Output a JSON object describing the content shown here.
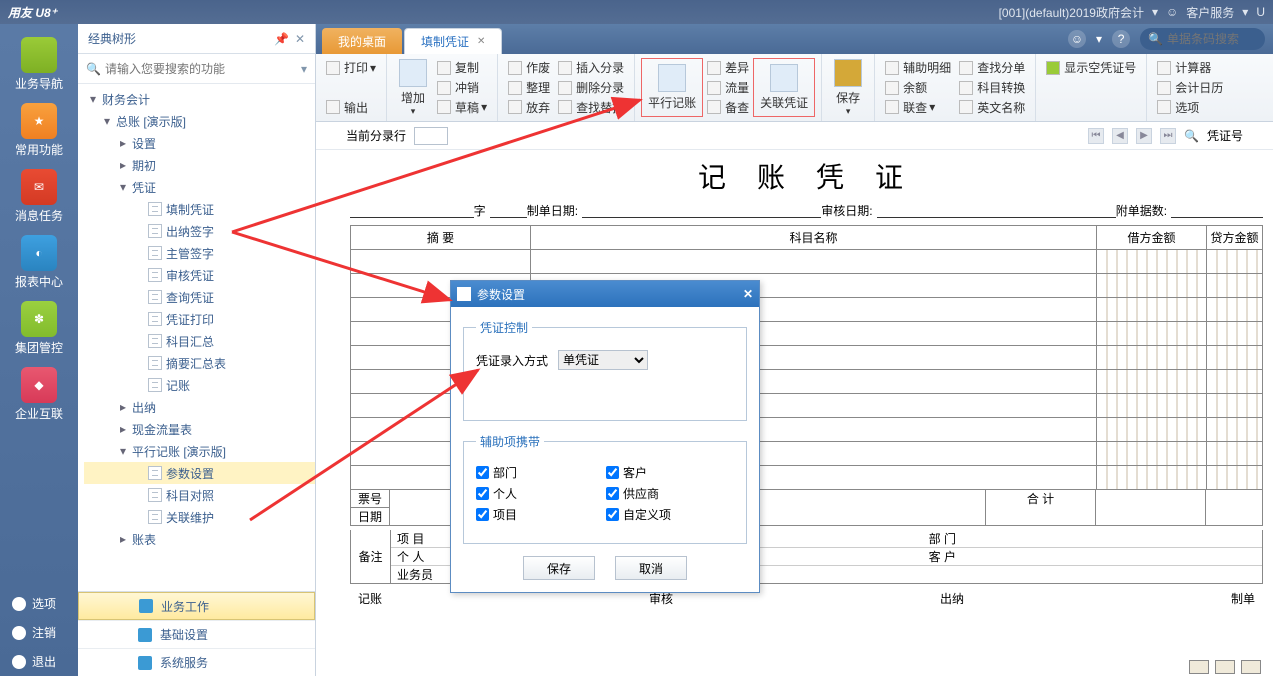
{
  "titlebar": {
    "logo": "用友 U8⁺",
    "org": "[001](default)2019政府会计",
    "service": "客户服务",
    "u": "U"
  },
  "leftrail": {
    "items": [
      {
        "label": "业务导航",
        "color": "c-green"
      },
      {
        "label": "常用功能",
        "color": "c-orange"
      },
      {
        "label": "消息任务",
        "color": "c-red"
      },
      {
        "label": "报表中心",
        "color": "c-blue"
      },
      {
        "label": "集团管控",
        "color": "c-lime"
      },
      {
        "label": "企业互联",
        "color": "c-pink"
      }
    ],
    "options": [
      {
        "label": "选项"
      },
      {
        "label": "注销"
      },
      {
        "label": "退出"
      }
    ]
  },
  "treepanel": {
    "title": "经典树形",
    "search_placeholder": "请输入您要搜索的功能",
    "root": "财务会计",
    "ledger": "总账 [演示版]",
    "pingxing": "平行记账 [演示版]",
    "nodes": {
      "settings": "设置",
      "initial": "期初",
      "voucher": "凭证",
      "fill": "填制凭证",
      "cashier": "出纳签字",
      "manager": "主管签字",
      "audit": "审核凭证",
      "query": "查询凭证",
      "print": "凭证打印",
      "subjsum": "科目汇总",
      "summarytab": "摘要汇总表",
      "post": "记账",
      "cashiernode": "出纳",
      "cashflow": "现金流量表",
      "param": "参数设置",
      "subjcmp": "科目对照",
      "relmaint": "关联维护",
      "acct": "账表"
    },
    "bottomtabs": {
      "work": "业务工作",
      "base": "基础设置",
      "sys": "系统服务"
    }
  },
  "tabs": {
    "desktop": "我的桌面",
    "fill": "填制凭证",
    "barcode_placeholder": "单据条码搜索"
  },
  "ribbon": {
    "print": "打印",
    "output": "输出",
    "add": "增加",
    "copy": "复制",
    "offset": "冲销",
    "draft": "草稿",
    "void": "作废",
    "tidy": "整理",
    "abandon": "放弃",
    "insertline": "插入分录",
    "deleteline": "删除分录",
    "findreplace": "查找替换",
    "parallel": "平行记账",
    "diff": "差异",
    "flow": "流量",
    "backup": "备查",
    "related": "关联凭证",
    "save": "保存",
    "auxdetail": "辅助明细",
    "balance": "余额",
    "relquery": "联查",
    "findsingle": "查找分单",
    "subjconv": "科目转换",
    "engname": "英文名称",
    "showblank": "显示空凭证号",
    "calc": "计算器",
    "calendar": "会计日历",
    "option": "选项"
  },
  "subbar": {
    "curline": "当前分录行",
    "voucherno": "凭证号"
  },
  "voucher": {
    "title": "记 账 凭 证",
    "zi": "字",
    "makedate": "制单日期:",
    "auditdate": "审核日期:",
    "attach": "附单据数:",
    "columns": {
      "summary": "摘 要",
      "subject": "科目名称",
      "debit": "借方金额",
      "credit": "贷方金额"
    },
    "bill": "票号",
    "date": "日期",
    "total": "合 计",
    "remark": "备注",
    "proj": "项 目",
    "person": "个 人",
    "operator": "业务员",
    "dept": "部 门",
    "customer": "客 户",
    "sign": {
      "post": "记账",
      "audit": "审核",
      "cashier": "出纳",
      "make": "制单"
    }
  },
  "dialog": {
    "title": "参数设置",
    "group1": "凭证控制",
    "inputmethod": "凭证录入方式",
    "inputmethod_value": "单凭证",
    "group2": "辅助项携带",
    "cb": {
      "dept": "部门",
      "customer": "客户",
      "person": "个人",
      "supplier": "供应商",
      "project": "项目",
      "custom": "自定义项"
    },
    "save": "保存",
    "cancel": "取消"
  }
}
